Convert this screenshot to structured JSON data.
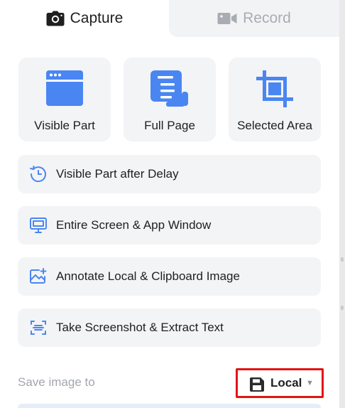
{
  "tabs": [
    {
      "label": "Capture",
      "icon": "camera-icon",
      "active": true
    },
    {
      "label": "Record",
      "icon": "video-camera-icon",
      "active": false
    }
  ],
  "capture_options": [
    {
      "label": "Visible Part",
      "icon": "browser-window-icon"
    },
    {
      "label": "Full Page",
      "icon": "scroll-page-icon"
    },
    {
      "label": "Selected Area",
      "icon": "crop-icon"
    }
  ],
  "more_options": [
    {
      "label": "Visible Part after Delay",
      "icon": "timer-icon"
    },
    {
      "label": "Entire Screen & App Window",
      "icon": "monitor-icon"
    },
    {
      "label": "Annotate Local & Clipboard Image",
      "icon": "image-edit-icon"
    },
    {
      "label": "Take Screenshot & Extract Text",
      "icon": "text-scan-icon"
    }
  ],
  "save": {
    "label": "Save image to",
    "selected": "Local",
    "icon": "floppy-disk-icon"
  },
  "colors": {
    "accent": "#4a86f2",
    "tile_bg": "#f3f4f6",
    "highlight_border": "#e31414",
    "muted_text": "#a2a6ad"
  }
}
